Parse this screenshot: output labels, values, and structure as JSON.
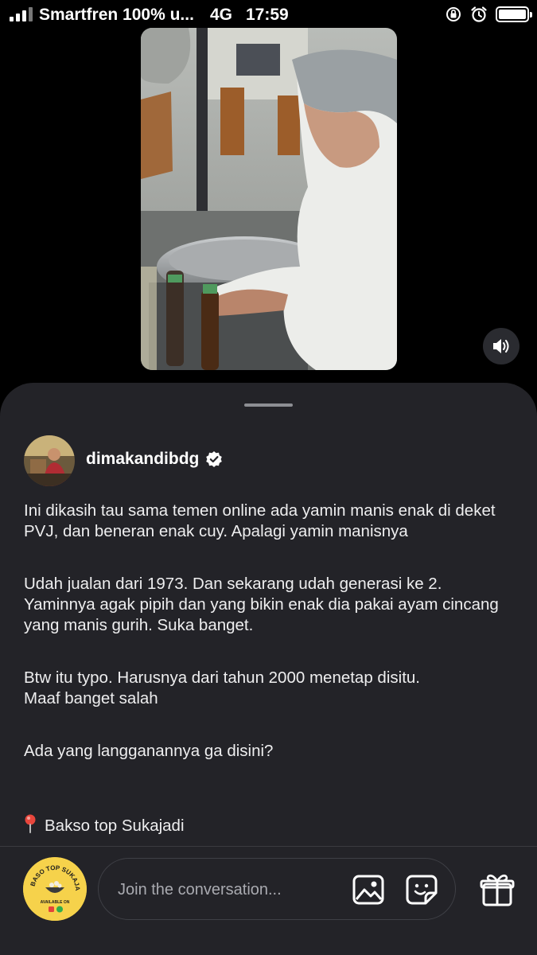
{
  "status_bar": {
    "carrier": "Smartfren 100% u...",
    "network": "4G",
    "time": "17:59",
    "icons": [
      "signal-icon",
      "orientation-lock-icon",
      "alarm-icon",
      "battery-icon"
    ]
  },
  "video": {
    "mute_icon": "speaker-icon"
  },
  "post": {
    "username": "dimakandibdg",
    "verified_icon": "verified-badge-icon",
    "caption": {
      "p1": "Ini dikasih tau sama temen online ada yamin manis enak di deket PVJ, dan beneran enak cuy. Apalagi yamin manisnya",
      "p2": "Udah jualan dari 1973. Dan sekarang udah generasi ke 2. Yaminnya agak pipih dan yang bikin enak dia pakai ayam cincang yang manis gurih. Suka banget.",
      "p3": "Btw itu typo. Harusnya dari tahun 2000 menetap disitu.\nMaaf banget salah",
      "p4": "Ada yang langganannya ga disini?",
      "location": "Bakso top Sukajadi"
    }
  },
  "composer": {
    "placeholder": "Join the conversation...",
    "shop_badge_text": "BASO TOP SUKAJADI",
    "shop_badge_sub": "AVAILABLE ON",
    "icons": [
      "image-icon",
      "sticker-icon",
      "gift-icon"
    ]
  },
  "colors": {
    "background": "#000000",
    "sheet": "#232328",
    "accent_pin": "#e8463c",
    "badge_yellow": "#f6d24b"
  }
}
